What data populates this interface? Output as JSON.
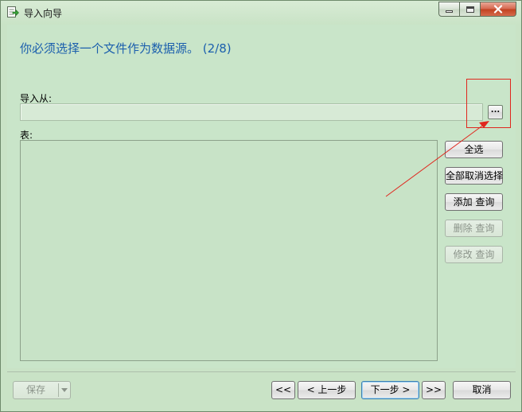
{
  "window": {
    "title": "导入向导",
    "icons": {
      "app": "import-wizard-icon",
      "minimize": "minimize-icon",
      "maximize": "maximize-icon",
      "close": "close-icon"
    }
  },
  "main": {
    "heading": "你必须选择一个文件作为数据源。 (2/8)",
    "import_from_label": "导入从:",
    "import_from_value": "",
    "browse_label": "...",
    "table_label": "表:"
  },
  "side_buttons": {
    "select_all": "全选",
    "deselect_all": "全部取消选择",
    "add_query": "添加 查询",
    "delete_query": "删除 查询",
    "edit_query": "修改 查询"
  },
  "footer": {
    "save": "保存",
    "first": "<<",
    "prev": "< 上一步",
    "next": "下一步 >",
    "last": ">>",
    "cancel": "取消"
  },
  "colors": {
    "heading": "#1b5fad",
    "annotation": "#e0271e",
    "disabled_text": "#8b948a"
  }
}
